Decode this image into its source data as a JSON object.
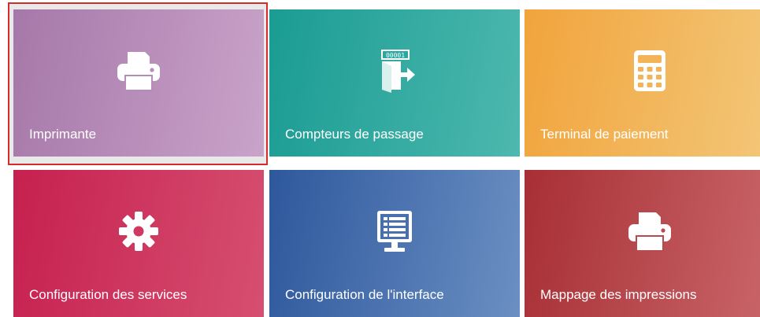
{
  "tiles": [
    {
      "label": "Imprimante",
      "icon": "printer-icon",
      "color": "#b68db8",
      "selected": true
    },
    {
      "label": "Compteurs de passage",
      "icon": "door-counter-icon",
      "counter_text": "00001",
      "color": "#2aa79e"
    },
    {
      "label": "Terminal de paiement",
      "icon": "calculator-icon",
      "color": "#f2b457"
    },
    {
      "label": "Configuration des services",
      "icon": "gear-icon",
      "color": "#cf3860"
    },
    {
      "label": "Configuration de l'interface",
      "icon": "monitor-list-icon",
      "color": "#4870ae"
    },
    {
      "label": "Mappage des impressions",
      "icon": "printer-icon",
      "color": "#b84a4f"
    }
  ],
  "selection_color": "#d62b2b"
}
